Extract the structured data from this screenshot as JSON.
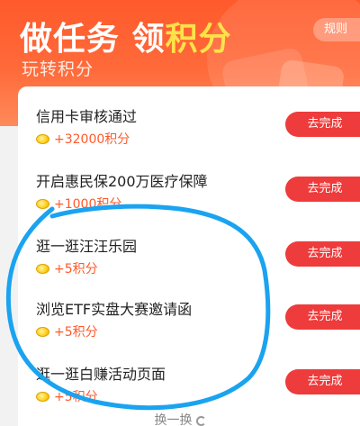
{
  "header": {
    "title_main": "做任务 领",
    "title_accent": "积分",
    "subtitle": "玩转积分",
    "rules_label": "规则"
  },
  "tasks": [
    {
      "title": "信用卡审核通过",
      "reward": "+32000积分",
      "action": "去完成"
    },
    {
      "title": "开启惠民保200万医疗保障",
      "reward": "+1000积分",
      "action": "去完成"
    },
    {
      "title": "逛一逛汪汪乐园",
      "reward": "+5积分",
      "action": "去完成"
    },
    {
      "title": "浏览ETF实盘大赛邀请函",
      "reward": "+5积分",
      "action": "去完成"
    },
    {
      "title": "逛一逛白赚活动页面",
      "reward": "+5积分",
      "action": "去完成"
    }
  ],
  "footer": {
    "refresh_label": "换一换"
  },
  "colors": {
    "header_bg": "#ff5a2b",
    "accent_text": "#ffe24a",
    "action_button": "#ee3b3b",
    "reward_text": "#ff5a2b",
    "annotation_stroke": "#1aa3f0"
  }
}
